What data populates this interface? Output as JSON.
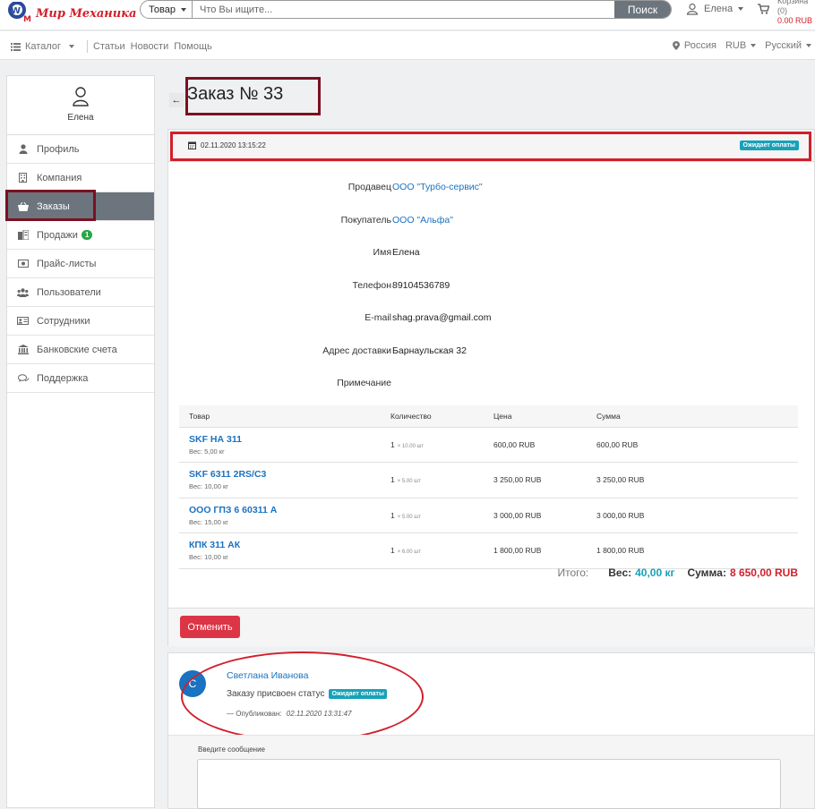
{
  "topbar": {
    "logo_text": "Мир Механика",
    "search_category": "Товар",
    "search_placeholder": "Что Вы ищите...",
    "search_button": "Поиск",
    "user_name": "Елена",
    "cart_label": "Корзина (0)",
    "cart_amount": "0.00 RUB"
  },
  "nav": {
    "catalog": "Каталог",
    "links": [
      "Статьи",
      "Новости",
      "Помощь"
    ],
    "region": "Россия",
    "currency": "RUB",
    "language": "Русский"
  },
  "sidebar": {
    "user_name": "Елена",
    "items": [
      {
        "label": "Профиль",
        "icon": "user-icon"
      },
      {
        "label": "Компания",
        "icon": "building-icon"
      },
      {
        "label": "Заказы",
        "icon": "basket-icon",
        "active": true
      },
      {
        "label": "Продажи",
        "icon": "sales-icon",
        "badge": "1"
      },
      {
        "label": "Прайс-листы",
        "icon": "money-icon"
      },
      {
        "label": "Пользователи",
        "icon": "users-icon"
      },
      {
        "label": "Сотрудники",
        "icon": "id-card-icon"
      },
      {
        "label": "Банковские счета",
        "icon": "bank-icon"
      },
      {
        "label": "Поддержка",
        "icon": "chat-icon"
      }
    ]
  },
  "order": {
    "title": "Заказ № 33",
    "datetime": "02.11.2020 13:15:22",
    "status": "Ожидает оплаты",
    "fields": [
      {
        "label": "Продавец",
        "value": "ООО \"Турбо-сервис\"",
        "link": true
      },
      {
        "label": "Покупатель",
        "value": "ООО \"Альфа\"",
        "link": true
      },
      {
        "label": "Имя",
        "value": "Елена"
      },
      {
        "label": "Телефон",
        "value": "89104536789"
      },
      {
        "label": "E-mail",
        "value": "shag.prava@gmail.com"
      },
      {
        "label": "Адрес доставки",
        "value": "Барнаульская 32"
      },
      {
        "label": "Примечание",
        "value": ""
      }
    ],
    "table": {
      "headers": [
        "Товар",
        "Количество",
        "Цена",
        "Сумма"
      ],
      "rows": [
        {
          "name": "SKF НА 311",
          "weight": "Вес: 5,00 кг",
          "qty": "1",
          "qty_unit": "× 10.00 шт",
          "price": "600,00 RUB",
          "sum": "600,00 RUB"
        },
        {
          "name": "SKF 6311 2RS/C3",
          "weight": "Вес: 10,00 кг",
          "qty": "1",
          "qty_unit": "× 5.00 шт",
          "price": "3 250,00 RUB",
          "sum": "3 250,00 RUB"
        },
        {
          "name": "ООО ГПЗ 6 60311 А",
          "weight": "Вес: 15,00 кг",
          "qty": "1",
          "qty_unit": "× 5.00 шт",
          "price": "3 000,00 RUB",
          "sum": "3 000,00 RUB"
        },
        {
          "name": "КПК 311 АК",
          "weight": "Вес: 10,00 кг",
          "qty": "1",
          "qty_unit": "× 6.00 шт",
          "price": "1 800,00 RUB",
          "sum": "1 800,00 RUB"
        }
      ]
    },
    "totals": {
      "label": "Итого:",
      "weight_label": "Вес:",
      "weight_value": "40,00 кг",
      "sum_label": "Сумма:",
      "sum_value": "8 650,00 RUB"
    },
    "cancel_button": "Отменить"
  },
  "comment": {
    "avatar_letter": "С",
    "author": "Светлана Иванова",
    "text": "Заказу присвоен статус",
    "status": "Ожидает оплаты",
    "meta_label": "— Опубликован:",
    "meta_date": "02.11.2020 13:31:47",
    "message_label": "Введите сообщение"
  },
  "colors": {
    "brand_red": "#d21f2b",
    "link_blue": "#1b72c0",
    "status_teal": "#17a2b8",
    "active_gray": "#6c757d",
    "annotation_maroon": "#7b1020"
  }
}
